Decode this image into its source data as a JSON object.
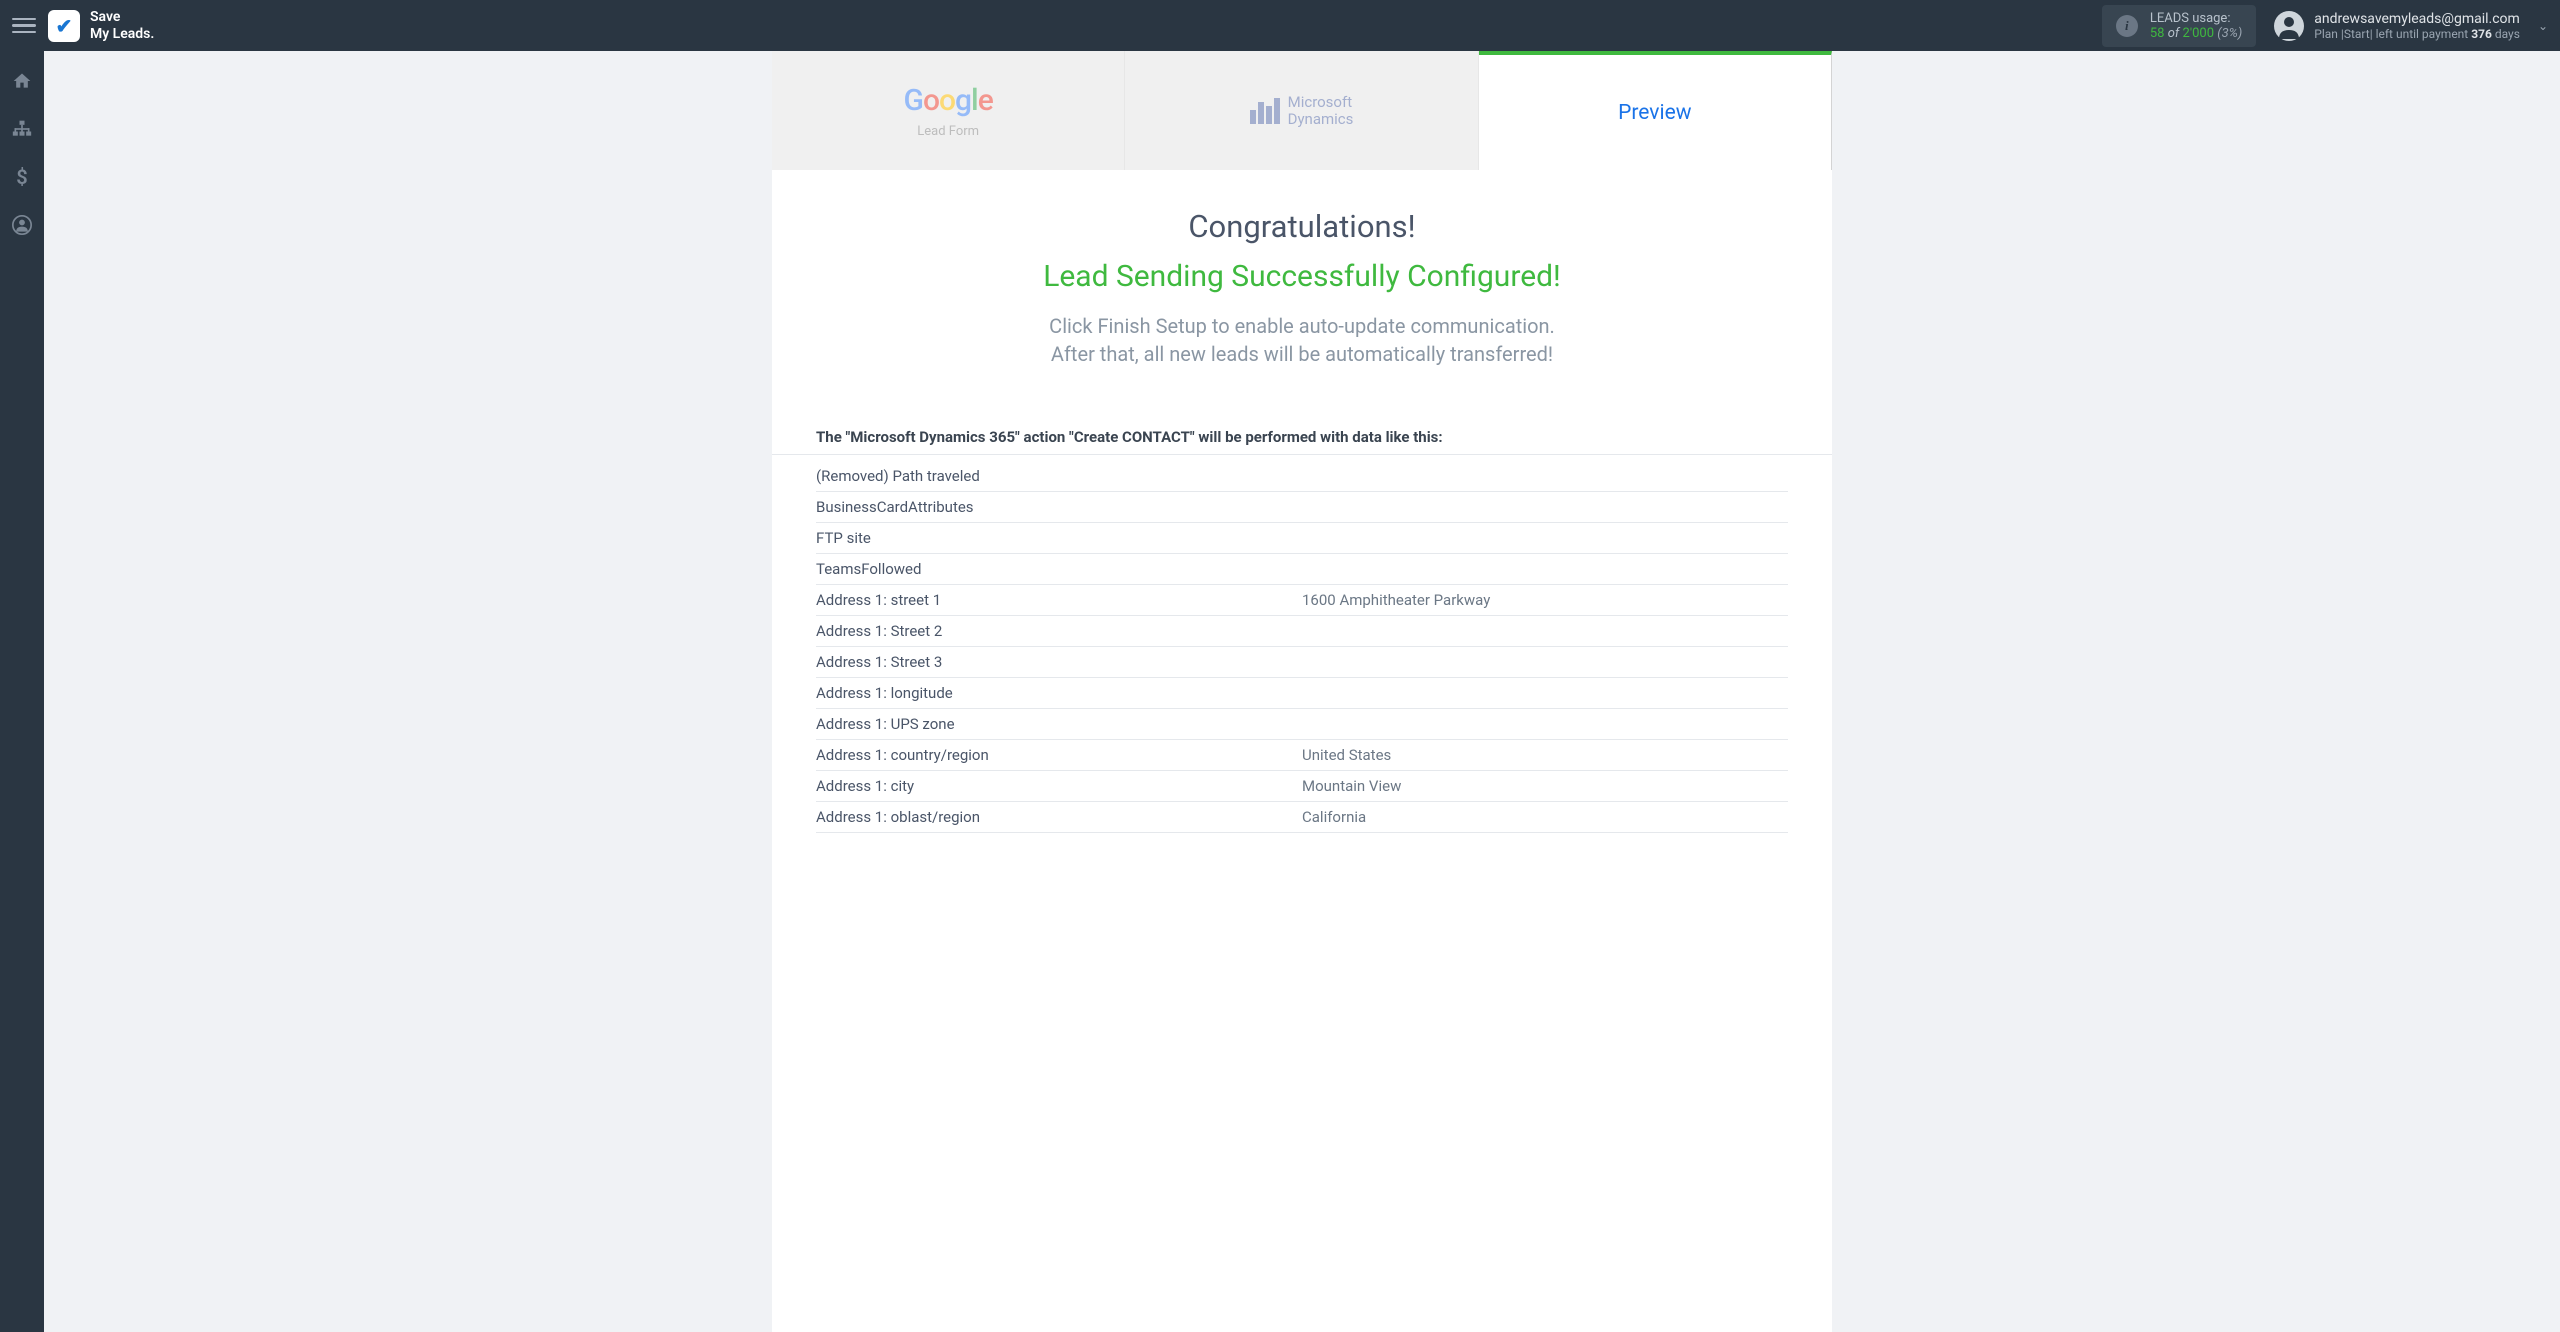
{
  "brand": {
    "line1": "Save",
    "line2": "My Leads."
  },
  "usage": {
    "label": "LEADS usage:",
    "current": "58",
    "of_word": "of",
    "max": "2'000",
    "pct": "(3%)"
  },
  "user": {
    "email": "andrewsavemyleads@gmail.com",
    "plan_prefix": "Plan |Start| left until payment ",
    "plan_days": "376",
    "plan_suffix": " days"
  },
  "tabs": {
    "google_label": "Lead Form",
    "dynamics_line1": "Microsoft",
    "dynamics_line2": "Dynamics",
    "preview": "Preview"
  },
  "congrats": {
    "title": "Congratulations!",
    "subtitle": "Lead Sending Successfully Configured!",
    "desc1": "Click Finish Setup to enable auto-update communication.",
    "desc2": "After that, all new leads will be automatically transferred!"
  },
  "table": {
    "intro": "The \"Microsoft Dynamics 365\" action \"Create CONTACT\" will be performed with data like this:",
    "rows": [
      {
        "key": "(Removed) Path traveled",
        "val": ""
      },
      {
        "key": "BusinessCardAttributes",
        "val": ""
      },
      {
        "key": "FTP site",
        "val": ""
      },
      {
        "key": "TeamsFollowed",
        "val": ""
      },
      {
        "key": "Address 1: street 1",
        "val": "1600 Amphitheater Parkway"
      },
      {
        "key": "Address 1: Street 2",
        "val": ""
      },
      {
        "key": "Address 1: Street 3",
        "val": ""
      },
      {
        "key": "Address 1: longitude",
        "val": ""
      },
      {
        "key": "Address 1: UPS zone",
        "val": ""
      },
      {
        "key": "Address 1: country/region",
        "val": "United States"
      },
      {
        "key": "Address 1: city",
        "val": "Mountain View"
      },
      {
        "key": "Address 1: oblast/region",
        "val": "California"
      }
    ]
  }
}
